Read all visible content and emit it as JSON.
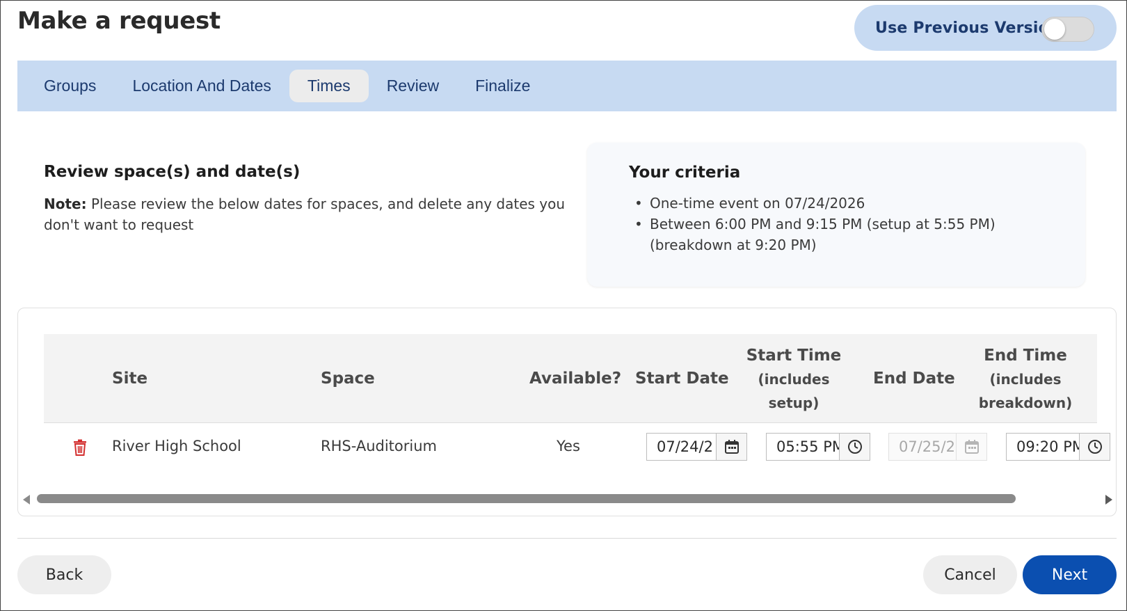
{
  "page": {
    "title": "Make a request"
  },
  "toggle": {
    "label": "Use Previous Version",
    "on": false
  },
  "tabs": [
    {
      "label": "Groups",
      "active": false
    },
    {
      "label": "Location And Dates",
      "active": false
    },
    {
      "label": "Times",
      "active": true
    },
    {
      "label": "Review",
      "active": false
    },
    {
      "label": "Finalize",
      "active": false
    }
  ],
  "review": {
    "heading": "Review space(s) and date(s)",
    "note_label": "Note:",
    "note_text": " Please review the below dates for spaces, and delete any dates you don't want to request"
  },
  "criteria": {
    "title": "Your criteria",
    "items": [
      "One-time event on 07/24/2026",
      "Between 6:00 PM and 9:15 PM (setup at 5:55 PM) (breakdown at 9:20 PM)"
    ]
  },
  "table": {
    "headers": {
      "site": "Site",
      "space": "Space",
      "available": "Available?",
      "start_date": "Start Date",
      "start_time": "Start Time",
      "start_time_sub1": "(includes",
      "start_time_sub2": "setup)",
      "end_date": "End Date",
      "end_time": "End Time",
      "end_time_sub1": "(includes",
      "end_time_sub2": "breakdown)"
    },
    "rows": [
      {
        "site": "River High School",
        "space": "RHS-Auditorium",
        "available": "Yes",
        "start_date": "07/24/2",
        "start_time": "05:55 PM",
        "end_date": "07/25/2",
        "end_time": "09:20 PM"
      }
    ]
  },
  "footer": {
    "back_label": "Back",
    "cancel_label": "Cancel",
    "next_label": "Next"
  },
  "colors": {
    "tab_bar": "#c7daf2",
    "primary_button": "#0b4fb0",
    "delete_icon": "#d32f2f"
  },
  "icons": [
    "trash-icon",
    "calendar-icon",
    "clock-icon",
    "scroll-left-arrow",
    "scroll-right-arrow"
  ]
}
